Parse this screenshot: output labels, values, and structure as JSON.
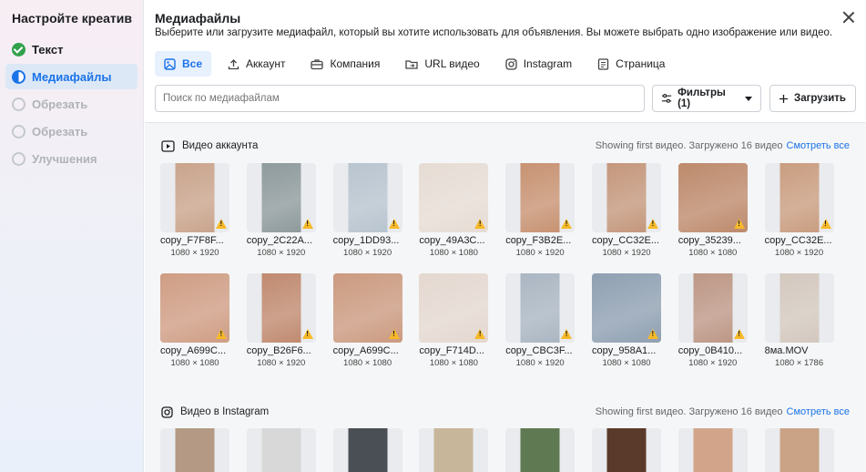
{
  "sidebar": {
    "title": "Настройте креатив",
    "steps": [
      {
        "label": "Текст",
        "state": "done"
      },
      {
        "label": "Медиафайлы",
        "state": "current"
      },
      {
        "label": "Обрезать",
        "state": "todo"
      },
      {
        "label": "Обрезать",
        "state": "todo"
      },
      {
        "label": "Улучшения",
        "state": "todo"
      }
    ]
  },
  "header": {
    "title": "Медиафайлы",
    "subtitle": "Выберите или загрузите медиафайл, который вы хотите использовать для объявления. Вы можете выбрать одно изображение или видео."
  },
  "tabs": [
    {
      "label": "Все",
      "icon": "image-icon",
      "active": true
    },
    {
      "label": "Аккаунт",
      "icon": "upload-icon",
      "active": false
    },
    {
      "label": "Компания",
      "icon": "briefcase-icon",
      "active": false
    },
    {
      "label": "URL видео",
      "icon": "folder-link-icon",
      "active": false
    },
    {
      "label": "Instagram",
      "icon": "instagram-icon",
      "active": false
    },
    {
      "label": "Страница",
      "icon": "page-icon",
      "active": false
    }
  ],
  "search": {
    "placeholder": "Поиск по медиафайлам",
    "value": ""
  },
  "filter_button": {
    "label": "Фильтры (1)"
  },
  "upload_button": {
    "label": "Загрузить"
  },
  "section_account": {
    "title": "Видео аккаунта",
    "meta": "Showing first видео. Загружено 16 видео",
    "see_all": "Смотреть все"
  },
  "section_instagram": {
    "title": "Видео в Instagram",
    "meta": "Showing first видео. Загружено 16 видео",
    "see_all": "Смотреть все"
  },
  "account_videos": [
    {
      "name": "copy_F7F8F...",
      "dims": "1080 × 1920",
      "shape": "portrait",
      "color": "#c9a48c",
      "warn": true
    },
    {
      "name": "copy_2C22A...",
      "dims": "1080 × 1920",
      "shape": "portrait",
      "color": "#8e9a9c",
      "warn": true
    },
    {
      "name": "copy_1DD93...",
      "dims": "1080 × 1920",
      "shape": "portrait",
      "color": "#b8c4cf",
      "warn": true
    },
    {
      "name": "copy_49A3C...",
      "dims": "1080 × 1080",
      "shape": "square",
      "color": "#e6dcd4",
      "warn": true
    },
    {
      "name": "copy_F3B2E...",
      "dims": "1080 × 1920",
      "shape": "portrait",
      "color": "#c79272",
      "warn": true
    },
    {
      "name": "copy_CC32E...",
      "dims": "1080 × 1920",
      "shape": "portrait",
      "color": "#c4977c",
      "warn": true
    },
    {
      "name": "copy_35239...",
      "dims": "1080 × 1080",
      "shape": "square",
      "color": "#bd8a6c",
      "warn": true
    },
    {
      "name": "copy_CC32E...",
      "dims": "1080 × 1920",
      "shape": "portrait",
      "color": "#c99d80",
      "warn": true
    },
    {
      "name": "copy_A699C...",
      "dims": "1080 × 1080",
      "shape": "square",
      "color": "#cf9d84",
      "warn": true
    },
    {
      "name": "copy_B26F6...",
      "dims": "1080 × 1920",
      "shape": "portrait",
      "color": "#c08a70",
      "warn": true
    },
    {
      "name": "copy_A699C...",
      "dims": "1080 × 1080",
      "shape": "square",
      "color": "#cb9a80",
      "warn": true
    },
    {
      "name": "copy_F714D...",
      "dims": "1080 × 1080",
      "shape": "square",
      "color": "#e4d8d0",
      "warn": true
    },
    {
      "name": "copy_CBC3F...",
      "dims": "1080 × 1920",
      "shape": "portrait",
      "color": "#aab6c2",
      "warn": true
    },
    {
      "name": "copy_958A1...",
      "dims": "1080 × 1080",
      "shape": "square",
      "color": "#8fa0b2",
      "warn": true
    },
    {
      "name": "copy_0B410...",
      "dims": "1080 × 1920",
      "shape": "portrait",
      "color": "#bd9786",
      "warn": true
    },
    {
      "name": "8ма.MOV",
      "dims": "1080 × 1786",
      "shape": "portrait",
      "color": "#d3c8be",
      "warn": false
    }
  ],
  "instagram_partial_colors": [
    "#b49a84",
    "#d8d8d8",
    "#4a4e55",
    "#c7b69a",
    "#5f7a52",
    "#5a3a2a",
    "#d2a58a",
    "#caa387"
  ]
}
